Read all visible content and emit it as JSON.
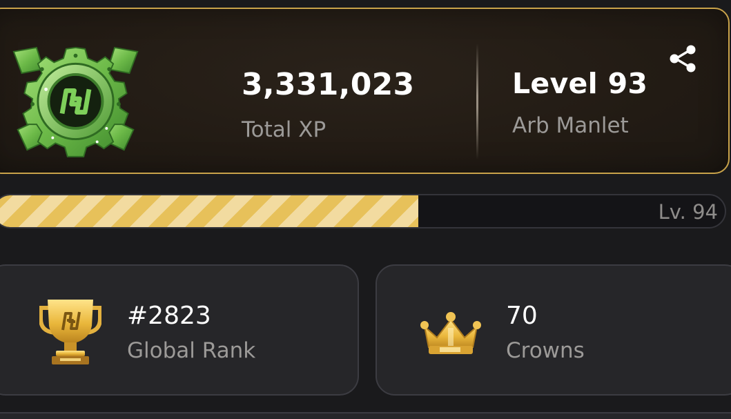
{
  "xp_card": {
    "total_xp_value": "3,331,023",
    "total_xp_label": "Total XP",
    "level_value": "Level 93",
    "level_title": "Arb Manlet",
    "badge_icon": "gear-badge-icon",
    "share_icon": "share-icon"
  },
  "progress": {
    "fraction": 0.58,
    "next_level_label": "Lv. 94",
    "colors": {
      "stripe_dark": "#e7c15a",
      "stripe_light": "#f2dba0"
    }
  },
  "stats": {
    "rank": {
      "value": "#2823",
      "label": "Global Rank",
      "icon": "trophy-icon"
    },
    "crowns": {
      "value": "70",
      "label": "Crowns",
      "icon": "crown-icon"
    }
  },
  "colors": {
    "accent_gold": "#c9a34a",
    "badge_green": "#6fbf4a",
    "card_bg": "#262629",
    "page_bg": "#1a1a1c"
  }
}
